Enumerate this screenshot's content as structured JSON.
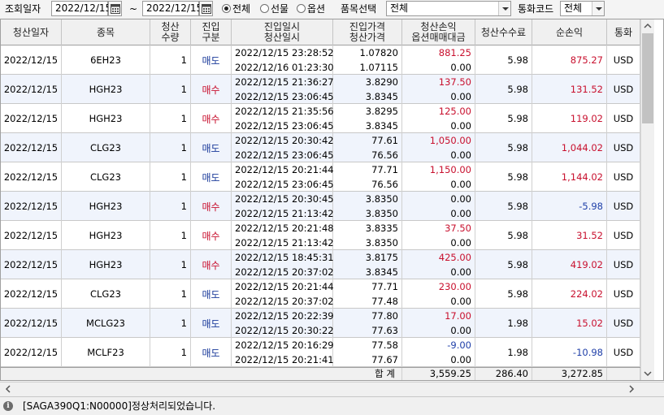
{
  "filter": {
    "date_label": "조회일자",
    "date_from": "2022/12/15",
    "tilde": "~",
    "date_to": "2022/12/15",
    "type_options": [
      "전체",
      "선물",
      "옵션"
    ],
    "type_selected": 0,
    "product_label": "품목선택",
    "product_value": "전체",
    "currency_label": "통화코드",
    "currency_value": "전체"
  },
  "columns": {
    "settle_date": "청산일자",
    "symbol": "종목",
    "qty": [
      "청산",
      "수량"
    ],
    "side": [
      "진입",
      "구분"
    ],
    "datetime": [
      "진입일시",
      "청산일시"
    ],
    "price": [
      "진입가격",
      "청산가격"
    ],
    "pnl": [
      "청산손익",
      "옵션매매대금"
    ],
    "fee": "청산수수료",
    "net": "순손익",
    "currency": "통화"
  },
  "rows": [
    {
      "date": "2022/12/15",
      "symbol": "6EH23",
      "qty": "1",
      "side": "매도",
      "side_type": "sell",
      "entry_time": "2022/12/15 23:28:52",
      "exit_time": "2022/12/16 01:23:30",
      "entry_price": "1.07820",
      "exit_price": "1.07115",
      "pnl": "881.25",
      "opt": "0.00",
      "fee": "5.98",
      "net": "875.27",
      "currency": "USD"
    },
    {
      "date": "2022/12/15",
      "symbol": "HGH23",
      "qty": "1",
      "side": "매수",
      "side_type": "buy",
      "entry_time": "2022/12/15 21:36:27",
      "exit_time": "2022/12/15 23:06:45",
      "entry_price": "3.8290",
      "exit_price": "3.8345",
      "pnl": "137.50",
      "opt": "0.00",
      "fee": "5.98",
      "net": "131.52",
      "currency": "USD"
    },
    {
      "date": "2022/12/15",
      "symbol": "HGH23",
      "qty": "1",
      "side": "매수",
      "side_type": "buy",
      "entry_time": "2022/12/15 21:35:56",
      "exit_time": "2022/12/15 23:06:45",
      "entry_price": "3.8295",
      "exit_price": "3.8345",
      "pnl": "125.00",
      "opt": "0.00",
      "fee": "5.98",
      "net": "119.02",
      "currency": "USD"
    },
    {
      "date": "2022/12/15",
      "symbol": "CLG23",
      "qty": "1",
      "side": "매도",
      "side_type": "sell",
      "entry_time": "2022/12/15 20:30:42",
      "exit_time": "2022/12/15 23:06:45",
      "entry_price": "77.61",
      "exit_price": "76.56",
      "pnl": "1,050.00",
      "opt": "0.00",
      "fee": "5.98",
      "net": "1,044.02",
      "currency": "USD"
    },
    {
      "date": "2022/12/15",
      "symbol": "CLG23",
      "qty": "1",
      "side": "매도",
      "side_type": "sell",
      "entry_time": "2022/12/15 20:21:44",
      "exit_time": "2022/12/15 23:06:45",
      "entry_price": "77.71",
      "exit_price": "76.56",
      "pnl": "1,150.00",
      "opt": "0.00",
      "fee": "5.98",
      "net": "1,144.02",
      "currency": "USD"
    },
    {
      "date": "2022/12/15",
      "symbol": "HGH23",
      "qty": "1",
      "side": "매수",
      "side_type": "buy",
      "entry_time": "2022/12/15 20:30:45",
      "exit_time": "2022/12/15 21:13:42",
      "entry_price": "3.8350",
      "exit_price": "3.8350",
      "pnl": "0.00",
      "opt": "0.00",
      "fee": "5.98",
      "net": "-5.98",
      "currency": "USD"
    },
    {
      "date": "2022/12/15",
      "symbol": "HGH23",
      "qty": "1",
      "side": "매수",
      "side_type": "buy",
      "entry_time": "2022/12/15 20:21:48",
      "exit_time": "2022/12/15 21:13:42",
      "entry_price": "3.8335",
      "exit_price": "3.8350",
      "pnl": "37.50",
      "opt": "0.00",
      "fee": "5.98",
      "net": "31.52",
      "currency": "USD"
    },
    {
      "date": "2022/12/15",
      "symbol": "HGH23",
      "qty": "1",
      "side": "매수",
      "side_type": "buy",
      "entry_time": "2022/12/15 18:45:31",
      "exit_time": "2022/12/15 20:37:02",
      "entry_price": "3.8175",
      "exit_price": "3.8345",
      "pnl": "425.00",
      "opt": "0.00",
      "fee": "5.98",
      "net": "419.02",
      "currency": "USD"
    },
    {
      "date": "2022/12/15",
      "symbol": "CLG23",
      "qty": "1",
      "side": "매도",
      "side_type": "sell",
      "entry_time": "2022/12/15 20:21:44",
      "exit_time": "2022/12/15 20:37:02",
      "entry_price": "77.71",
      "exit_price": "77.48",
      "pnl": "230.00",
      "opt": "0.00",
      "fee": "5.98",
      "net": "224.02",
      "currency": "USD"
    },
    {
      "date": "2022/12/15",
      "symbol": "MCLG23",
      "qty": "1",
      "side": "매도",
      "side_type": "sell",
      "entry_time": "2022/12/15 20:22:39",
      "exit_time": "2022/12/15 20:30:22",
      "entry_price": "77.80",
      "exit_price": "77.63",
      "pnl": "17.00",
      "opt": "0.00",
      "fee": "1.98",
      "net": "15.02",
      "currency": "USD"
    },
    {
      "date": "2022/12/15",
      "symbol": "MCLF23",
      "qty": "1",
      "side": "매도",
      "side_type": "sell",
      "entry_time": "2022/12/15 20:16:29",
      "exit_time": "2022/12/15 20:21:41",
      "entry_price": "77.58",
      "exit_price": "77.67",
      "pnl": "-9.00",
      "opt": "0.00",
      "fee": "1.98",
      "net": "-10.98",
      "currency": "USD"
    }
  ],
  "total": {
    "label": "합  계",
    "pnl": "3,559.25",
    "fee": "286.40",
    "net": "3,272.85"
  },
  "status": {
    "message": "[SAGA390Q1:N00000]정상처리되었습니다."
  },
  "colors": {
    "positive": "#c8102e",
    "negative": "#1f3fa8",
    "sell": "#1a3a9a",
    "buy": "#c8102e"
  }
}
